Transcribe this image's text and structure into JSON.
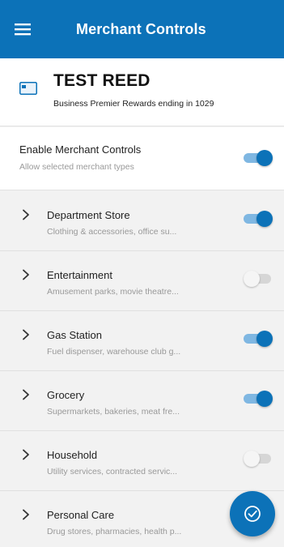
{
  "appbar": {
    "title": "Merchant Controls",
    "menu_icon": "hamburger-menu-icon"
  },
  "card": {
    "name": "TEST REED",
    "description": "Business Premier Rewards ending in 1029",
    "icon": "credit-card-icon"
  },
  "enable": {
    "title": "Enable Merchant Controls",
    "subtitle": "Allow selected merchant types",
    "enabled": true
  },
  "categories": [
    {
      "title": "Department Store",
      "subtitle": "Clothing & accessories, office su...",
      "enabled": true
    },
    {
      "title": "Entertainment",
      "subtitle": "Amusement parks, movie theatre...",
      "enabled": false
    },
    {
      "title": "Gas Station",
      "subtitle": "Fuel dispenser, warehouse club g...",
      "enabled": true
    },
    {
      "title": "Grocery",
      "subtitle": "Supermarkets, bakeries, meat fre...",
      "enabled": true
    },
    {
      "title": "Household",
      "subtitle": "Utility services, contracted servic...",
      "enabled": false
    },
    {
      "title": "Personal Care",
      "subtitle": "Drug stores, pharmacies, health p...",
      "enabled": false
    }
  ],
  "fab": {
    "icon": "checkmark-circle-icon"
  },
  "colors": {
    "primary": "#0c72b8",
    "toggle_track_on": "#7fb7e2",
    "background": "#f2f2f2"
  }
}
